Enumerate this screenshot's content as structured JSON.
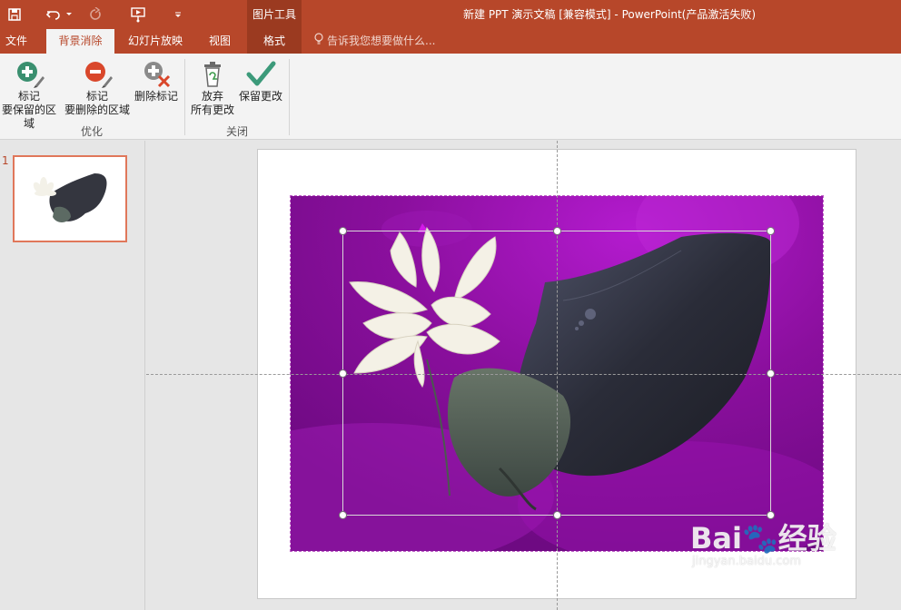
{
  "window": {
    "title": "新建 PPT 演示文稿 [兼容模式] - PowerPoint(产品激活失败)",
    "context_group": "图片工具"
  },
  "qat": {
    "save_icon": "save-icon",
    "undo_icon": "undo-icon",
    "redo_icon": "redo-icon",
    "presenter_icon": "start-from-beginning-icon",
    "customize_icon": "customize-qat-icon"
  },
  "tabs": [
    {
      "label": "文件"
    },
    {
      "label": "背景消除"
    },
    {
      "label": "幻灯片放映"
    },
    {
      "label": "视图"
    },
    {
      "label": "格式"
    }
  ],
  "tellme": {
    "text": "告诉我您想要做什么..."
  },
  "ribbon": {
    "buttons": [
      {
        "line1": "标记",
        "line2": "要保留的区域",
        "icon": "mark-keep-icon"
      },
      {
        "line1": "标记",
        "line2": "要删除的区域",
        "icon": "mark-remove-icon"
      },
      {
        "line1": "删除标记",
        "line2": "",
        "icon": "delete-mark-icon"
      },
      {
        "line1": "放弃",
        "line2": "所有更改",
        "icon": "discard-changes-icon"
      },
      {
        "line1": "保留更改",
        "line2": "",
        "icon": "keep-changes-icon"
      }
    ],
    "groups": [
      {
        "label": "优化"
      },
      {
        "label": "关闭"
      }
    ],
    "colors": {
      "add": "#3a8f6f",
      "remove": "#d9472b",
      "check": "#3c9a7a"
    }
  },
  "thumbnails": [
    {
      "number": "1"
    }
  ],
  "watermark": {
    "main": "Bai🐾经验",
    "sub": "jingyan.baidu.com"
  },
  "theme": {
    "accent": "#b7472a",
    "removal_overlay": "#8a0fa0"
  }
}
